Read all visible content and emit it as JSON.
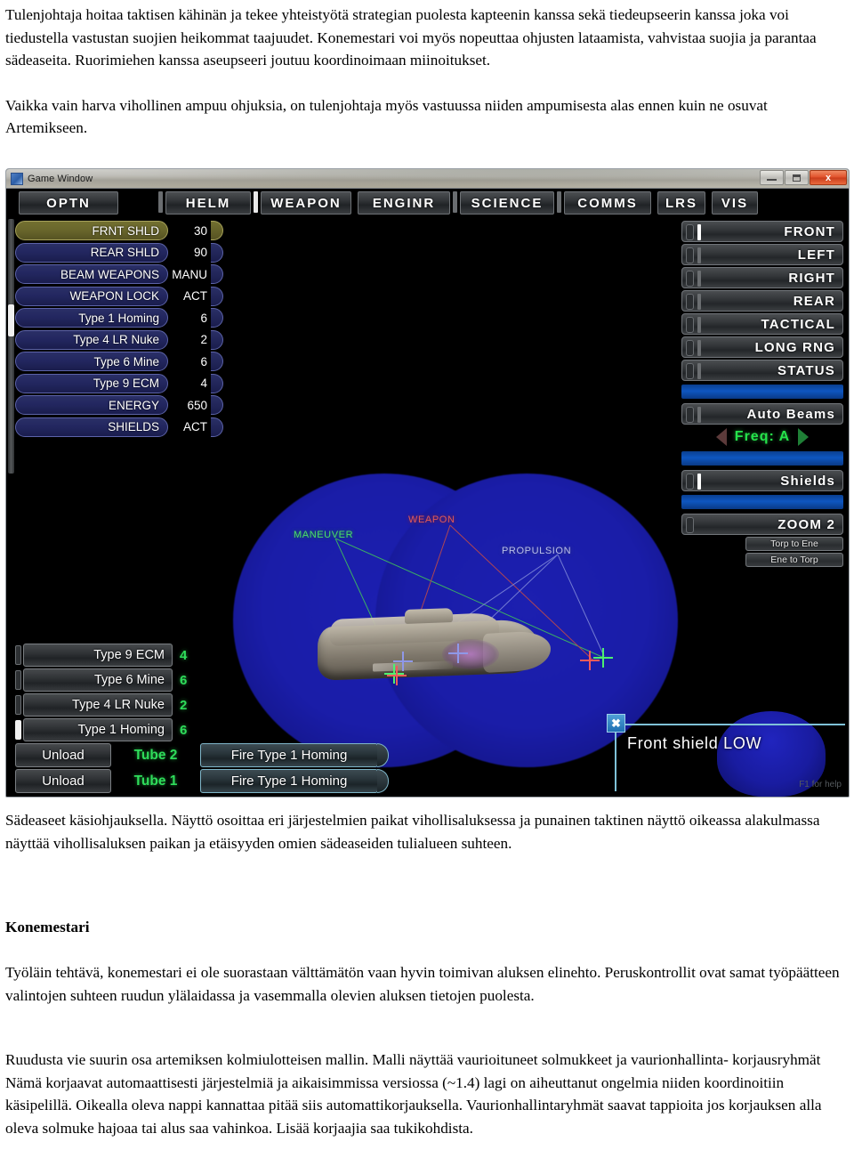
{
  "document": {
    "paragraphs": [
      "Tulenjohtaja hoitaa taktisen kähinän ja tekee yhteistyötä strategian puolesta kapteenin kanssa sekä tiedeupseerin kanssa joka voi tiedustella vastustan suojien heikommat taajuudet. Konemestari voi myös nopeuttaa ohjusten lataamista, vahvistaa suojia ja parantaa sädeaseita. Ruorimiehen kanssa aseupseeri joutuu koordinoimaan miinoitukset.",
      "Vaikka vain harva vihollinen ampuu ohjuksia, on tulenjohtaja myös vastuussa niiden ampumisesta alas ennen kuin ne osuvat Artemikseen."
    ],
    "caption": "Sädeaseet käsiohjauksella. Näyttö osoittaa eri järjestelmien paikat vihollisaluksessa ja punainen taktinen näyttö oikeassa alakulmassa näyttää vihollisaluksen paikan ja etäisyyden omien sädeaseiden tulialueen suhteen.",
    "section_heading": "Konemestari",
    "section_paragraphs": [
      "Työläin tehtävä, konemestari ei ole suorastaan välttämätön vaan hyvin toimivan aluksen elinehto. Peruskontrollit ovat samat työpäätteen valintojen suhteen ruudun ylälaidassa ja vasemmalla olevien aluksen tietojen puolesta.",
      "Ruudusta vie suurin osa artemiksen kolmiulotteisen mallin. Malli näyttää vaurioituneet solmukkeet ja vaurionhallinta- korjausryhmät Nämä korjaavat automaattisesti järjestelmiä ja aikaisimmissa versiossa (~1.4) lagi on aiheuttanut ongelmia niiden koordinoitiin käsipelillä. Oikealla oleva nappi kannattaa pitää siis automattikorjauksella. Vaurionhallintaryhmät saavat tappioita jos korjauksen alla oleva solmuke hajoaa tai alus saa vahinkoa. Lisää korjaajia saa tukikohdista."
    ]
  },
  "window": {
    "title": "Game Window",
    "minimize_label": "",
    "maximize_label": "",
    "close_label": "x"
  },
  "navbar": {
    "buttons": [
      {
        "label": "OPTN"
      },
      {
        "label": "HELM"
      },
      {
        "label": "WEAPON"
      },
      {
        "label": "ENGINR"
      },
      {
        "label": "SCIENCE"
      },
      {
        "label": "COMMS"
      },
      {
        "label": "LRS"
      },
      {
        "label": "VIS"
      }
    ]
  },
  "systems": {
    "rows": [
      {
        "name": "FRNT SHLD",
        "value": "30",
        "active": true
      },
      {
        "name": "REAR SHLD",
        "value": "90",
        "active": false
      },
      {
        "name": "BEAM WEAPONS",
        "value": "MANU",
        "active": false
      },
      {
        "name": "WEAPON LOCK",
        "value": "ACT",
        "active": false
      },
      {
        "name": "Type 1 Homing",
        "value": "6",
        "active": false
      },
      {
        "name": "Type 4 LR Nuke",
        "value": "2",
        "active": false
      },
      {
        "name": "Type 6 Mine",
        "value": "6",
        "active": false
      },
      {
        "name": "Type 9 ECM",
        "value": "4",
        "active": false
      },
      {
        "name": "ENERGY",
        "value": "650",
        "active": false
      },
      {
        "name": "SHIELDS",
        "value": "ACT",
        "active": false
      }
    ]
  },
  "right_controls": {
    "views": [
      {
        "label": "FRONT",
        "selected": true
      },
      {
        "label": "LEFT",
        "selected": false
      },
      {
        "label": "RIGHT",
        "selected": false
      },
      {
        "label": "REAR",
        "selected": false
      },
      {
        "label": "TACTICAL",
        "selected": false
      },
      {
        "label": "LONG RNG",
        "selected": false
      },
      {
        "label": "STATUS",
        "selected": false
      }
    ],
    "auto_beams_label": "Auto Beams",
    "frequency_label": "Freq: A",
    "shields_label": "Shields",
    "zoom_label": "ZOOM 2",
    "torp_to_ene_label": "Torp to Ene",
    "ene_to_torp_label": "Ene to Torp"
  },
  "torpedoes": {
    "rows": [
      {
        "name": "Type 9 ECM",
        "count": "4",
        "selected": false
      },
      {
        "name": "Type 6 Mine",
        "count": "6",
        "selected": false
      },
      {
        "name": "Type 4 LR Nuke",
        "count": "2",
        "selected": false
      },
      {
        "name": "Type 1 Homing",
        "count": "6",
        "selected": true
      }
    ],
    "tubes": [
      {
        "unload_label": "Unload",
        "tube_label": "Tube 2",
        "fire_label": "Fire Type 1 Homing"
      },
      {
        "unload_label": "Unload",
        "tube_label": "Tube 1",
        "fire_label": "Fire Type 1 Homing"
      }
    ]
  },
  "viewport": {
    "node_labels": [
      {
        "label": "MANEUVER",
        "color": "#49e06a"
      },
      {
        "label": "WEAPON",
        "color": "#e05a5a"
      },
      {
        "label": "PROPULSION",
        "color": "#b9bfe8"
      }
    ],
    "message": "Front shield LOW",
    "message_close_glyph": "✖",
    "help_hint": "F1 for help"
  }
}
